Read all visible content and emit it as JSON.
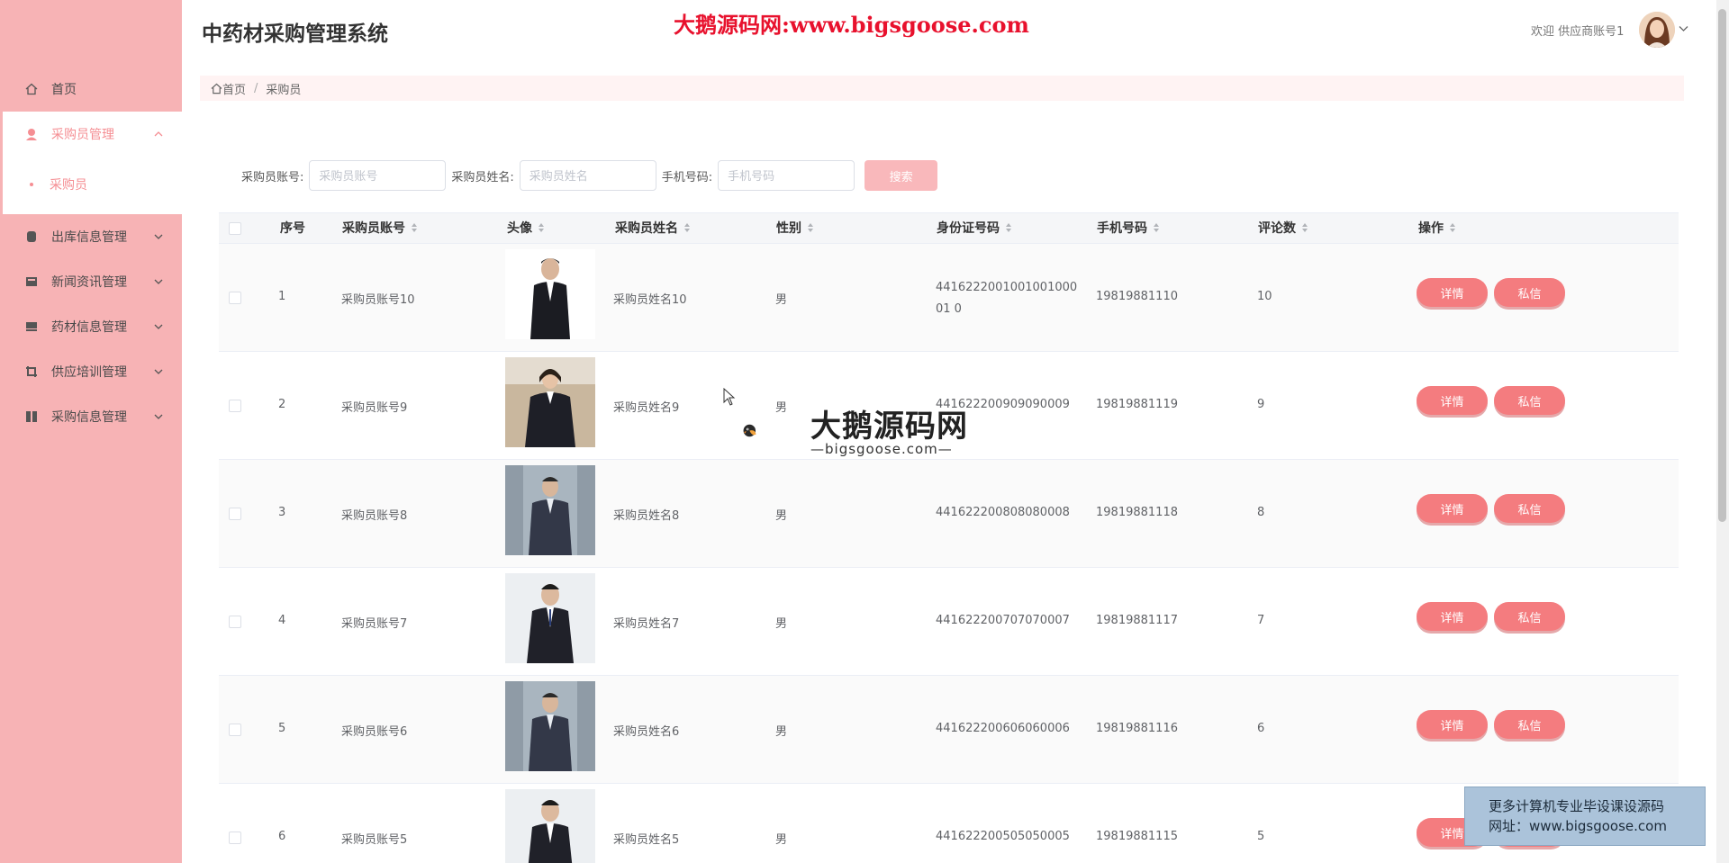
{
  "app": {
    "title": "中药材采购管理系统",
    "banner": "大鹅源码网:www.bigsgoose.com",
    "welcome": "欢迎 供应商账号1"
  },
  "sidebar": {
    "home": "首页",
    "group_open": "采购员管理",
    "sub_item": "采购员",
    "items": [
      {
        "label": "出库信息管理",
        "icon": "box-icon"
      },
      {
        "label": "新闻资讯管理",
        "icon": "news-icon"
      },
      {
        "label": "药材信息管理",
        "icon": "herb-icon"
      },
      {
        "label": "供应培训管理",
        "icon": "training-icon"
      },
      {
        "label": "采购信息管理",
        "icon": "purchase-icon"
      }
    ]
  },
  "breadcrumb": {
    "home": "首页",
    "current": "采购员"
  },
  "search": {
    "account_label": "采购员账号:",
    "account_placeholder": "采购员账号",
    "name_label": "采购员姓名:",
    "name_placeholder": "采购员姓名",
    "phone_label": "手机号码:",
    "phone_placeholder": "手机号码",
    "button": "搜索"
  },
  "table": {
    "headers": [
      "序号",
      "采购员账号",
      "头像",
      "采购员姓名",
      "性别",
      "身份证号码",
      "手机号码",
      "评论数",
      "操作"
    ],
    "rows": [
      {
        "no": "1",
        "account": "采购员账号10",
        "name": "采购员姓名10",
        "gender": "男",
        "idcard": "441622200100100100001 0",
        "phone": "19819881110",
        "comments": "10"
      },
      {
        "no": "2",
        "account": "采购员账号9",
        "name": "采购员姓名9",
        "gender": "男",
        "idcard": "441622200909090009",
        "phone": "19819881119",
        "comments": "9"
      },
      {
        "no": "3",
        "account": "采购员账号8",
        "name": "采购员姓名8",
        "gender": "男",
        "idcard": "441622200808080008",
        "phone": "19819881118",
        "comments": "8"
      },
      {
        "no": "4",
        "account": "采购员账号7",
        "name": "采购员姓名7",
        "gender": "男",
        "idcard": "441622200707070007",
        "phone": "19819881117",
        "comments": "7"
      },
      {
        "no": "5",
        "account": "采购员账号6",
        "name": "采购员姓名6",
        "gender": "男",
        "idcard": "441622200606060006",
        "phone": "19819881116",
        "comments": "6"
      },
      {
        "no": "6",
        "account": "采购员账号5",
        "name": "采购员姓名5",
        "gender": "男",
        "idcard": "441622200505050005",
        "phone": "19819881115",
        "comments": "5"
      }
    ],
    "detail_btn": "详情",
    "message_btn": "私信"
  },
  "overlays": {
    "watermark_title": "大鹅源码网",
    "watermark_sub": "—bigsgoose.com—",
    "ad_line1": "更多计算机专业毕设课设源码",
    "ad_line2": "网址：www.bigsgoose.com"
  },
  "colors": {
    "sidebar": "#f7b3b5",
    "accent": "#f58e93",
    "button": "#f47c7f",
    "banner": "#e8112d"
  }
}
